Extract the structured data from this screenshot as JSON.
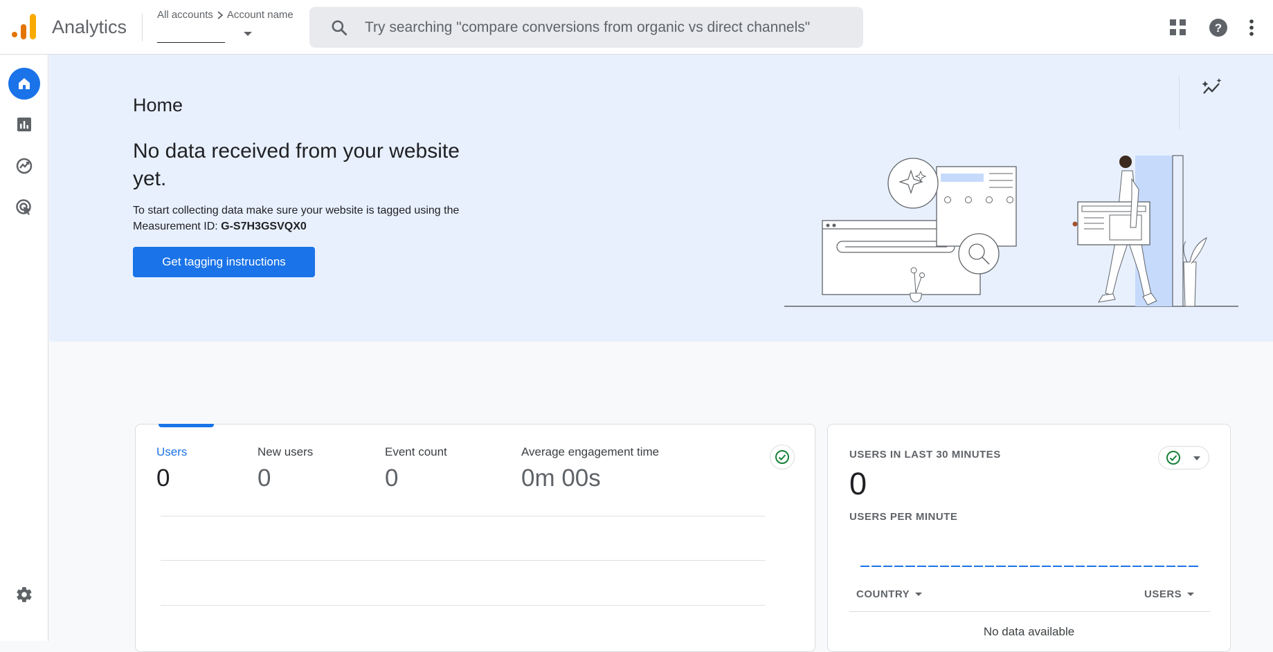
{
  "app": {
    "name": "Analytics"
  },
  "breadcrumb": {
    "root": "All accounts",
    "current": "Account name",
    "selected_property": "___________"
  },
  "search": {
    "placeholder": "Try searching \"compare conversions from organic vs direct channels\""
  },
  "topbar_icons": [
    "apps-grid-icon",
    "help-icon",
    "more-vert-icon"
  ],
  "nav": {
    "items": [
      {
        "name": "home-icon",
        "active": true
      },
      {
        "name": "reports-icon",
        "active": false
      },
      {
        "name": "explore-icon",
        "active": false
      },
      {
        "name": "advertising-icon",
        "active": false
      }
    ],
    "settings_icon": "gear-icon"
  },
  "hero": {
    "page_title": "Home",
    "heading": "No data received from your website yet.",
    "text_prefix": "To start collecting data make sure your website is tagged using the Measurement ID: ",
    "measurement_id": "G-S7H3GSVQX0",
    "button_label": "Get tagging instructions"
  },
  "metrics": [
    {
      "label": "Users",
      "value": "0",
      "active": true
    },
    {
      "label": "New users",
      "value": "0",
      "active": false
    },
    {
      "label": "Event count",
      "value": "0",
      "active": false
    },
    {
      "label": "Average engagement time",
      "value": "0m 00s",
      "active": false
    }
  ],
  "realtime": {
    "title": "USERS IN LAST 30 MINUTES",
    "value": "0",
    "subtitle": "USERS PER MINUTE",
    "columns": [
      "COUNTRY",
      "USERS"
    ],
    "empty_text": "No data available"
  },
  "colors": {
    "accent": "#1a73e8",
    "hero_bg": "#e8f0fe",
    "success": "#188038"
  }
}
